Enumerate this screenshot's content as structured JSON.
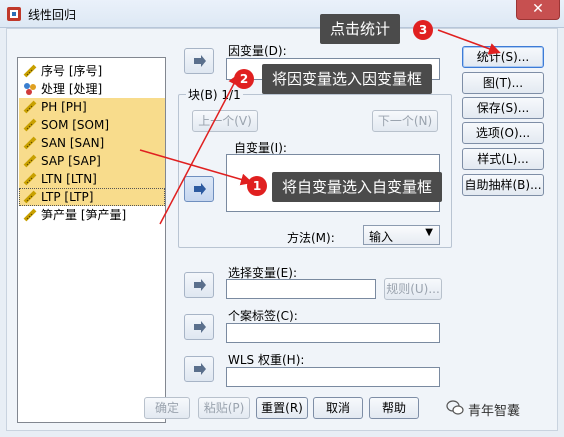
{
  "window": {
    "title": "线性回归",
    "close_glyph": "✕"
  },
  "variables": [
    {
      "label": "序号 [序号]",
      "icon": "ruler-icon",
      "selected": false
    },
    {
      "label": "处理 [处理]",
      "icon": "nominal-icon",
      "selected": false
    },
    {
      "label": "PH    [PH]",
      "icon": "ruler-icon",
      "selected": true
    },
    {
      "label": "SOM    [SOM]",
      "icon": "ruler-icon",
      "selected": true
    },
    {
      "label": "SAN    [SAN]",
      "icon": "ruler-icon",
      "selected": true
    },
    {
      "label": "SAP    [SAP]",
      "icon": "ruler-icon",
      "selected": true
    },
    {
      "label": "LTN    [LTN]",
      "icon": "ruler-icon",
      "selected": true
    },
    {
      "label": "LTP    [LTP]",
      "icon": "ruler-icon",
      "selected": true
    },
    {
      "label": "笋产量      [笋产量]",
      "icon": "ruler-icon",
      "selected": false
    }
  ],
  "dependent": {
    "label": "因变量(D):"
  },
  "block": {
    "label": "块(B) 1/1",
    "prev_label": "上一个(V)",
    "next_label": "下一个(N)"
  },
  "independent": {
    "label": "自变量(I):"
  },
  "method": {
    "label": "方法(M):",
    "value": "输入"
  },
  "selection": {
    "label": "选择变量(E):",
    "rule_label": "规则(U)..."
  },
  "case_labels": {
    "label": "个案标签(C):"
  },
  "wls": {
    "label": "WLS 权重(H):"
  },
  "side_buttons": [
    "统计(S)...",
    "图(T)...",
    "保存(S)...",
    "选项(O)...",
    "样式(L)...",
    "自助抽样(B)..."
  ],
  "bottom_buttons": {
    "ok": "确定",
    "paste": "粘贴(P)",
    "reset": "重置(R)",
    "cancel": "取消",
    "help": "帮助"
  },
  "annotations": {
    "stats": {
      "number": "3",
      "text": "点击统计"
    },
    "dependent": {
      "number": "2",
      "text": "将因变量选入因变量框"
    },
    "independent": {
      "number": "1",
      "text": "将自变量选入自变量框"
    }
  },
  "watermark": "青年智囊",
  "colors": {
    "selection": "#f8dc8c",
    "annotation_red": "#e02020",
    "tip_bg": "#4b4b4b",
    "close_red": "#c75050"
  }
}
